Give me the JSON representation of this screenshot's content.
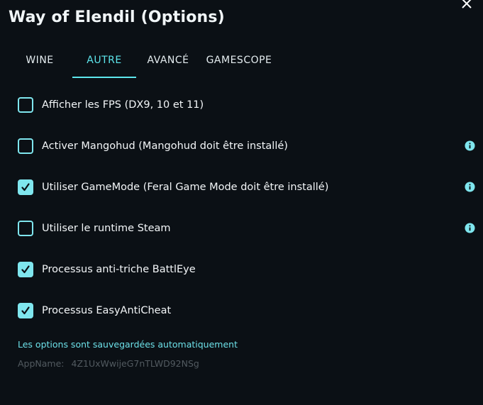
{
  "window": {
    "title": "Way of Elendil (Options)"
  },
  "tabs": [
    {
      "label": "WINE"
    },
    {
      "label": "AUTRE"
    },
    {
      "label": "AVANCÉ"
    },
    {
      "label": "GAMESCOPE"
    }
  ],
  "active_tab": "AUTRE",
  "options": [
    {
      "label": "Afficher les FPS (DX9, 10 et 11)",
      "checked": false,
      "info": false
    },
    {
      "label": "Activer Mangohud (Mangohud doit être installé)",
      "checked": false,
      "info": true
    },
    {
      "label": "Utiliser GameMode (Feral Game Mode doit être installé)",
      "checked": true,
      "info": true
    },
    {
      "label": "Utiliser le runtime Steam",
      "checked": false,
      "info": true
    },
    {
      "label": "Processus anti-triche BattlEye",
      "checked": true,
      "info": false
    },
    {
      "label": "Processus EasyAntiCheat",
      "checked": true,
      "info": false
    }
  ],
  "footer": {
    "autosave_note": "Les options sont sauvegardées automatiquement",
    "appname_label": "AppName:",
    "appname_value": "4Z1UxWwijeG7nTLWD92NSg"
  },
  "colors": {
    "accent": "#5de6ec",
    "checkbox": "#7fe6ee",
    "background": "#0b1015"
  },
  "icons": {
    "close": "close-icon",
    "info": "info-icon",
    "check": "checkmark-icon"
  }
}
